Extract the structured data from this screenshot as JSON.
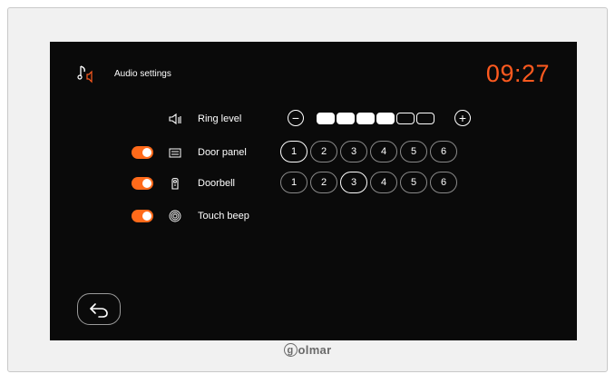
{
  "header": {
    "title": "Audio settings",
    "clock": "09:27",
    "icon": "music-note-speaker-icon"
  },
  "colors": {
    "accent": "#ff5a1f",
    "toggle": "#ff6a1a",
    "screen_bg": "#0a0a0a"
  },
  "ring_level": {
    "label": "Ring level",
    "minus_symbol": "−",
    "plus_symbol": "+",
    "level": 4,
    "max": 6
  },
  "rows": [
    {
      "label": "Door panel",
      "toggle_on": true,
      "icon": "door-panel-icon",
      "tones": [
        "1",
        "2",
        "3",
        "4",
        "5",
        "6"
      ],
      "selected": "1"
    },
    {
      "label": "Doorbell",
      "toggle_on": true,
      "icon": "doorbell-icon",
      "tones": [
        "1",
        "2",
        "3",
        "4",
        "5",
        "6"
      ],
      "selected": "3"
    },
    {
      "label": "Touch beep",
      "toggle_on": true,
      "icon": "fingerprint-icon"
    }
  ],
  "back": {
    "icon": "back-arrow-icon"
  },
  "brand": {
    "logo_letter": "g",
    "name_rest": "olmar"
  }
}
